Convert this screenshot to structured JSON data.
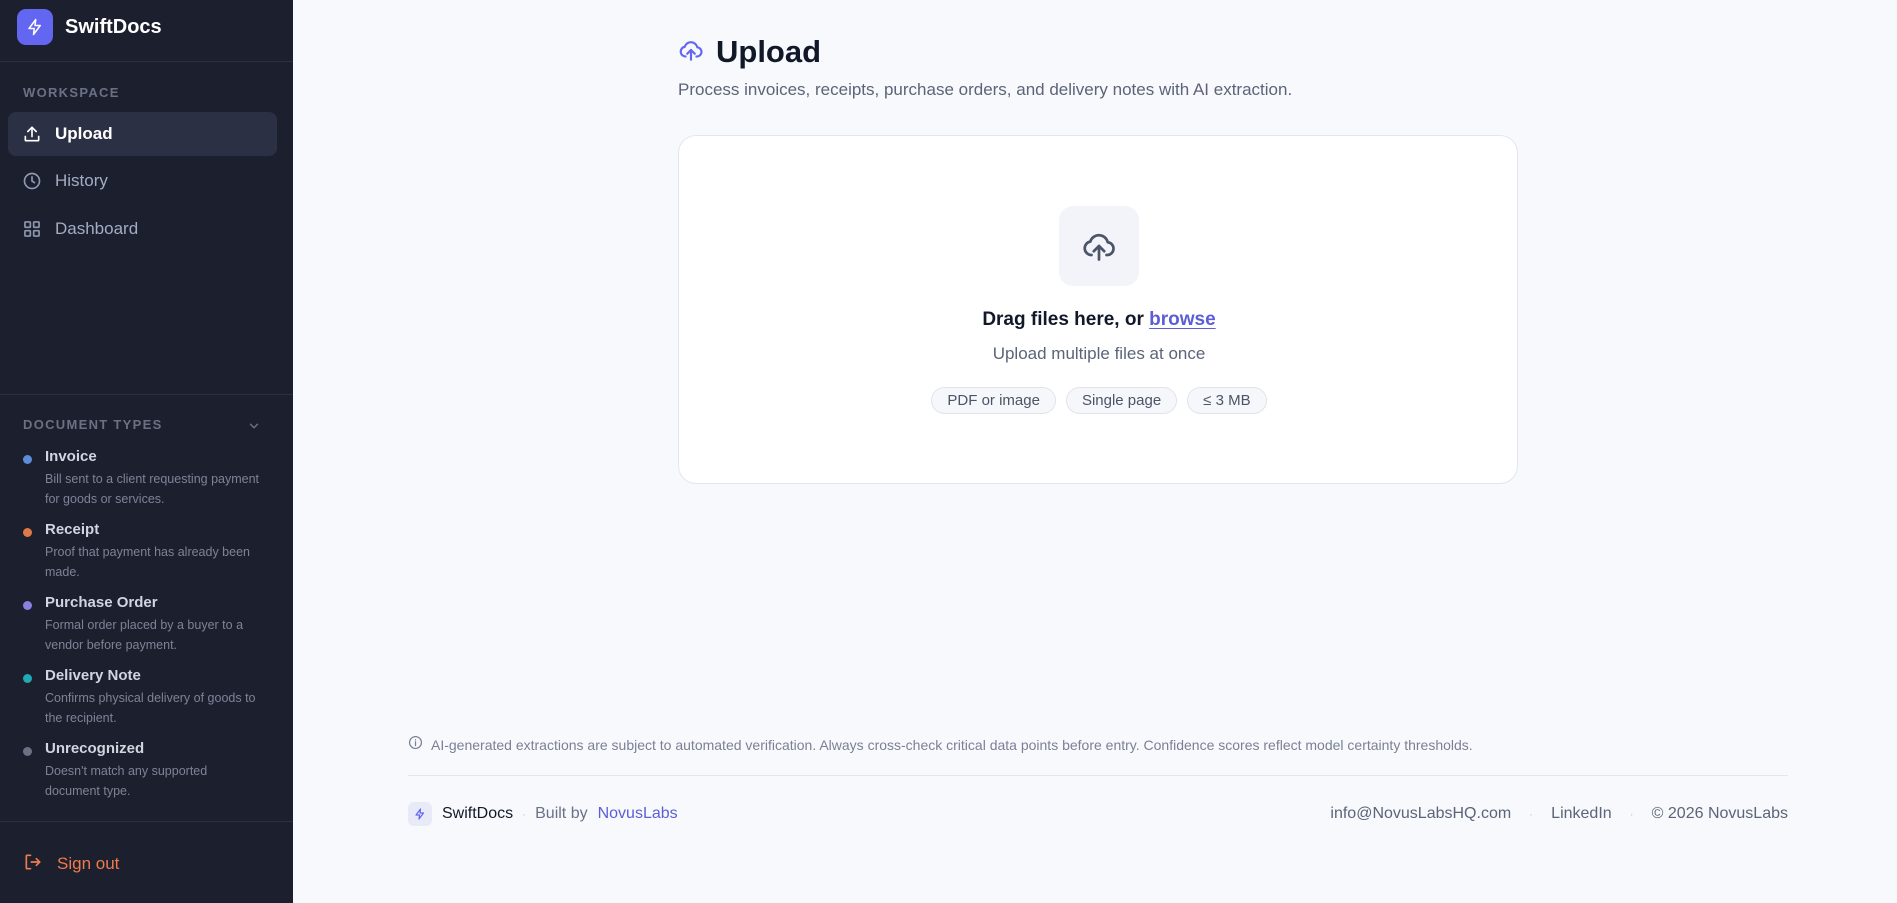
{
  "app": {
    "name": "SwiftDocs"
  },
  "sidebar": {
    "workspace_label": "WORKSPACE",
    "nav": [
      {
        "label": "Upload",
        "icon": "upload-icon",
        "active": true
      },
      {
        "label": "History",
        "icon": "clock-icon",
        "active": false
      },
      {
        "label": "Dashboard",
        "icon": "grid-icon",
        "active": false
      }
    ],
    "doc_types_label": "DOCUMENT TYPES",
    "doc_types": [
      {
        "name": "Invoice",
        "desc": "Bill sent to a client requesting payment for goods or services.",
        "color": "#5b8ed6"
      },
      {
        "name": "Receipt",
        "desc": "Proof that payment has already been made.",
        "color": "#e07a45"
      },
      {
        "name": "Purchase Order",
        "desc": "Formal order placed by a buyer to a vendor before payment.",
        "color": "#8b7fe0"
      },
      {
        "name": "Delivery Note",
        "desc": "Confirms physical delivery of goods to the recipient.",
        "color": "#22a9b5"
      },
      {
        "name": "Unrecognized",
        "desc": "Doesn't match any supported document type.",
        "color": "#6b7184"
      }
    ],
    "signout_label": "Sign out"
  },
  "main": {
    "title": "Upload",
    "subtitle": "Process invoices, receipts, purchase orders, and delivery notes with AI extraction.",
    "dropzone": {
      "prompt": "Drag files here, or ",
      "browse": "browse",
      "sub": "Upload multiple files at once",
      "chips": [
        "PDF or image",
        "Single page",
        "≤ 3 MB"
      ]
    },
    "disclaimer": "AI-generated extractions are subject to automated verification. Always cross-check critical data points before entry. Confidence scores reflect model certainty thresholds."
  },
  "footer": {
    "brand": "SwiftDocs",
    "built_by": "Built by",
    "company": "NovusLabs",
    "email": "info@NovusLabsHQ.com",
    "linkedin": "LinkedIn",
    "copyright": "© 2026 NovusLabs"
  },
  "colors": {
    "accent": "#6366f1",
    "sidebar_bg": "#1c1f2e",
    "signout": "#f07a4e",
    "link": "#5b5fd6"
  }
}
